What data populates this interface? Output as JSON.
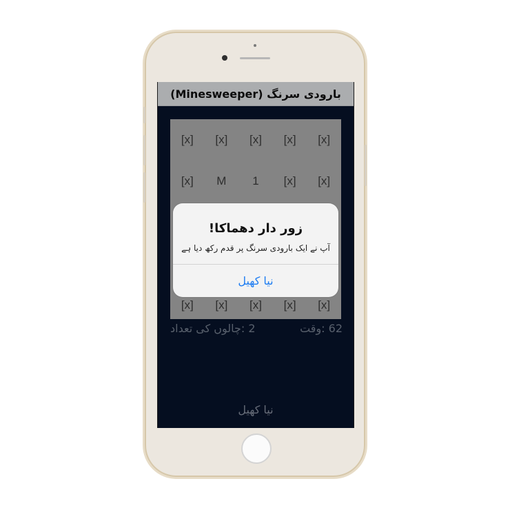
{
  "app": {
    "title": "بارودی سرنگ (Minesweeper)"
  },
  "board": {
    "rows": [
      [
        "[x]",
        "[x]",
        "[x]",
        "[x]",
        "[x]"
      ],
      [
        "[x]",
        "M",
        "1",
        "[x]",
        "[x]"
      ],
      [
        "[x]",
        "[x]",
        "[x]",
        "[x]",
        "[x]"
      ]
    ]
  },
  "stats": {
    "moves": "2 :چالوں کی تعداد",
    "time": "62 :وقت"
  },
  "bottom": {
    "new_game": "نیا کھیل"
  },
  "alert": {
    "title": "زور دار دھماکا!",
    "message": "آپ نے ایک بارودی سرنگ پر قدم رکھ دیا ہے",
    "button": "نیا کھیل"
  },
  "colors": {
    "screen_background": "#07142d",
    "board_background": "#b7b7b7",
    "accent_blue": "#1d7cf2"
  }
}
